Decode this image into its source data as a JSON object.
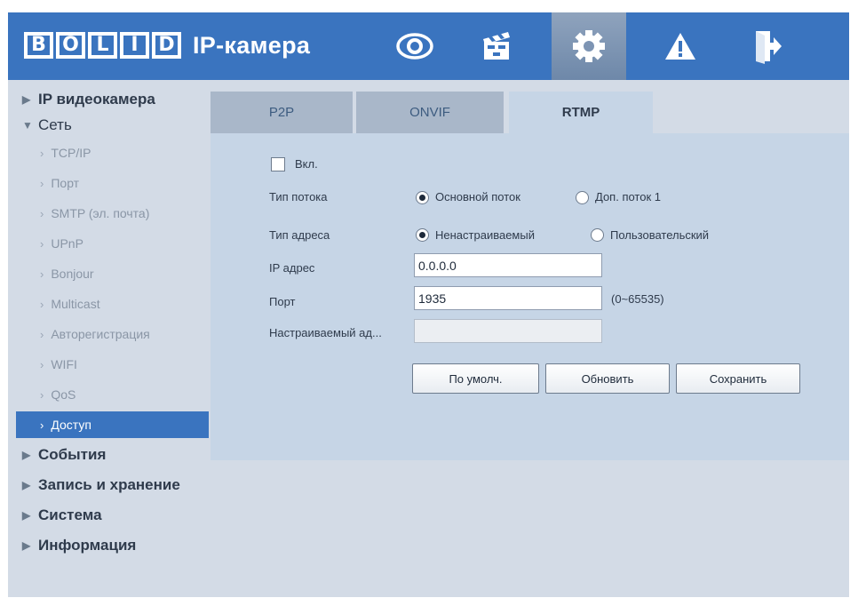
{
  "header": {
    "logo_text": "BOLID",
    "logo_letters": [
      "B",
      "O",
      "L",
      "I",
      "D"
    ],
    "product": "IP-камера",
    "nav": [
      {
        "icon": "eye-icon"
      },
      {
        "icon": "clapperboard-icon"
      },
      {
        "icon": "gear-icon",
        "active": true
      },
      {
        "icon": "warning-icon"
      },
      {
        "icon": "logout-icon"
      }
    ]
  },
  "sidebar": {
    "top_category": "IP видеокамера",
    "network_category": "Сеть",
    "network_items": [
      "TCP/IP",
      "Порт",
      "SMTP (эл. почта)",
      "UPnP",
      "Bonjour",
      "Multicast",
      "Авторегистрация",
      "WIFI",
      "QoS",
      "Доступ"
    ],
    "active_item": "Доступ",
    "bottom_categories": [
      "События",
      "Запись и хранение",
      "Система",
      "Информация"
    ]
  },
  "tabs": [
    "P2P",
    "ONVIF",
    "RTMP"
  ],
  "active_tab": "RTMP",
  "form": {
    "enable_label": "Вкл.",
    "enable_checked": false,
    "stream_type_label": "Тип потока",
    "stream_options": [
      "Основной поток",
      "Доп. поток 1"
    ],
    "stream_selected": "Основной поток",
    "address_type_label": "Тип адреса",
    "address_options": [
      "Ненастраиваемый",
      "Пользовательский"
    ],
    "address_selected": "Ненастраиваемый",
    "ip_label": "IP адрес",
    "ip_value": "0.0.0.0",
    "port_label": "Порт",
    "port_value": "1935",
    "port_range": "(0~65535)",
    "custom_address_label": "Настраиваемый ад...",
    "custom_address_value": ""
  },
  "buttons": {
    "default": "По умолч.",
    "refresh": "Обновить",
    "save": "Сохранить"
  },
  "colors": {
    "header_blue": "#3a74bf",
    "panel_bg": "#d3dbe6",
    "content_bg": "#c6d5e6",
    "tab_inactive": "#a9b7c9"
  }
}
